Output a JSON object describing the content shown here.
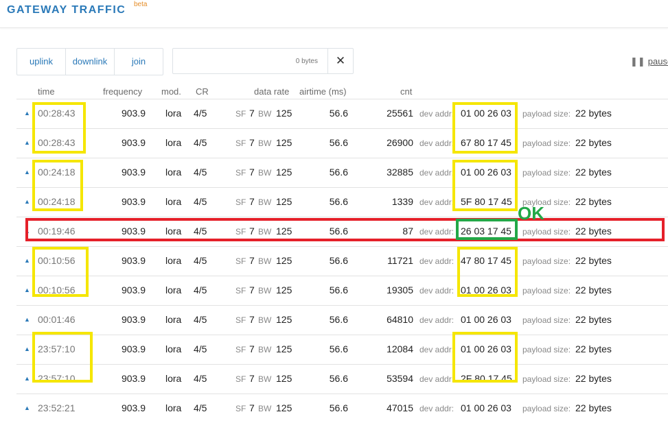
{
  "header": {
    "title": "GATEWAY TRAFFIC",
    "badge": "beta"
  },
  "filters": {
    "uplink": "uplink",
    "downlink": "downlink",
    "join": "join"
  },
  "search": {
    "placeholder": "0 bytes",
    "clear_icon": "close-icon"
  },
  "pause": {
    "icon": "pause-icon",
    "label": "pause"
  },
  "columns": {
    "time": "time",
    "frequency": "frequency",
    "mod": "mod.",
    "cr": "CR",
    "data_rate": "data rate",
    "airtime": "airtime (ms)",
    "cnt": "cnt"
  },
  "labels": {
    "sf": "SF",
    "bw": "BW",
    "dev_addr": "dev addr:",
    "payload_size": "payload size:"
  },
  "annotation": {
    "ok": "OK"
  },
  "colors": {
    "accent": "#2a79b8",
    "highlight_yellow": "#f5e600",
    "highlight_green": "#22a847",
    "highlight_red": "#e5202a"
  },
  "rows": [
    {
      "arrow": "▲",
      "time": "00:28:43",
      "freq": "903.9",
      "mod": "lora",
      "cr": "4/5",
      "sf": "7",
      "bw": "125",
      "airtime": "56.6",
      "cnt": "25561",
      "dev_addr": "01 00 26 03",
      "payload": "22 bytes"
    },
    {
      "arrow": "▲",
      "time": "00:28:43",
      "freq": "903.9",
      "mod": "lora",
      "cr": "4/5",
      "sf": "7",
      "bw": "125",
      "airtime": "56.6",
      "cnt": "26900",
      "dev_addr": "67 80 17 45",
      "payload": "22 bytes"
    },
    {
      "arrow": "▲",
      "time": "00:24:18",
      "freq": "903.9",
      "mod": "lora",
      "cr": "4/5",
      "sf": "7",
      "bw": "125",
      "airtime": "56.6",
      "cnt": "32885",
      "dev_addr": "01 00 26 03",
      "payload": "22 bytes"
    },
    {
      "arrow": "▲",
      "time": "00:24:18",
      "freq": "903.9",
      "mod": "lora",
      "cr": "4/5",
      "sf": "7",
      "bw": "125",
      "airtime": "56.6",
      "cnt": "1339",
      "dev_addr": "5F 80 17 45",
      "payload": "22 bytes"
    },
    {
      "arrow": "▲",
      "time": "00:19:46",
      "freq": "903.9",
      "mod": "lora",
      "cr": "4/5",
      "sf": "7",
      "bw": "125",
      "airtime": "56.6",
      "cnt": "87",
      "dev_addr": "26 03 17 45",
      "payload": "22 bytes"
    },
    {
      "arrow": "▲",
      "time": "00:10:56",
      "freq": "903.9",
      "mod": "lora",
      "cr": "4/5",
      "sf": "7",
      "bw": "125",
      "airtime": "56.6",
      "cnt": "11721",
      "dev_addr": "47 80 17 45",
      "payload": "22 bytes"
    },
    {
      "arrow": "▲",
      "time": "00:10:56",
      "freq": "903.9",
      "mod": "lora",
      "cr": "4/5",
      "sf": "7",
      "bw": "125",
      "airtime": "56.6",
      "cnt": "19305",
      "dev_addr": "01 00 26 03",
      "payload": "22 bytes"
    },
    {
      "arrow": "▲",
      "time": "00:01:46",
      "freq": "903.9",
      "mod": "lora",
      "cr": "4/5",
      "sf": "7",
      "bw": "125",
      "airtime": "56.6",
      "cnt": "64810",
      "dev_addr": "01 00 26 03",
      "payload": "22 bytes"
    },
    {
      "arrow": "▲",
      "time": "23:57:10",
      "freq": "903.9",
      "mod": "lora",
      "cr": "4/5",
      "sf": "7",
      "bw": "125",
      "airtime": "56.6",
      "cnt": "12084",
      "dev_addr": "01 00 26 03",
      "payload": "22 bytes"
    },
    {
      "arrow": "▲",
      "time": "23:57:10",
      "freq": "903.9",
      "mod": "lora",
      "cr": "4/5",
      "sf": "7",
      "bw": "125",
      "airtime": "56.6",
      "cnt": "53594",
      "dev_addr": "2F 80 17 45",
      "payload": "22 bytes"
    },
    {
      "arrow": "▲",
      "time": "23:52:21",
      "freq": "903.9",
      "mod": "lora",
      "cr": "4/5",
      "sf": "7",
      "bw": "125",
      "airtime": "56.6",
      "cnt": "47015",
      "dev_addr": "01 00 26 03",
      "payload": "22 bytes"
    }
  ]
}
